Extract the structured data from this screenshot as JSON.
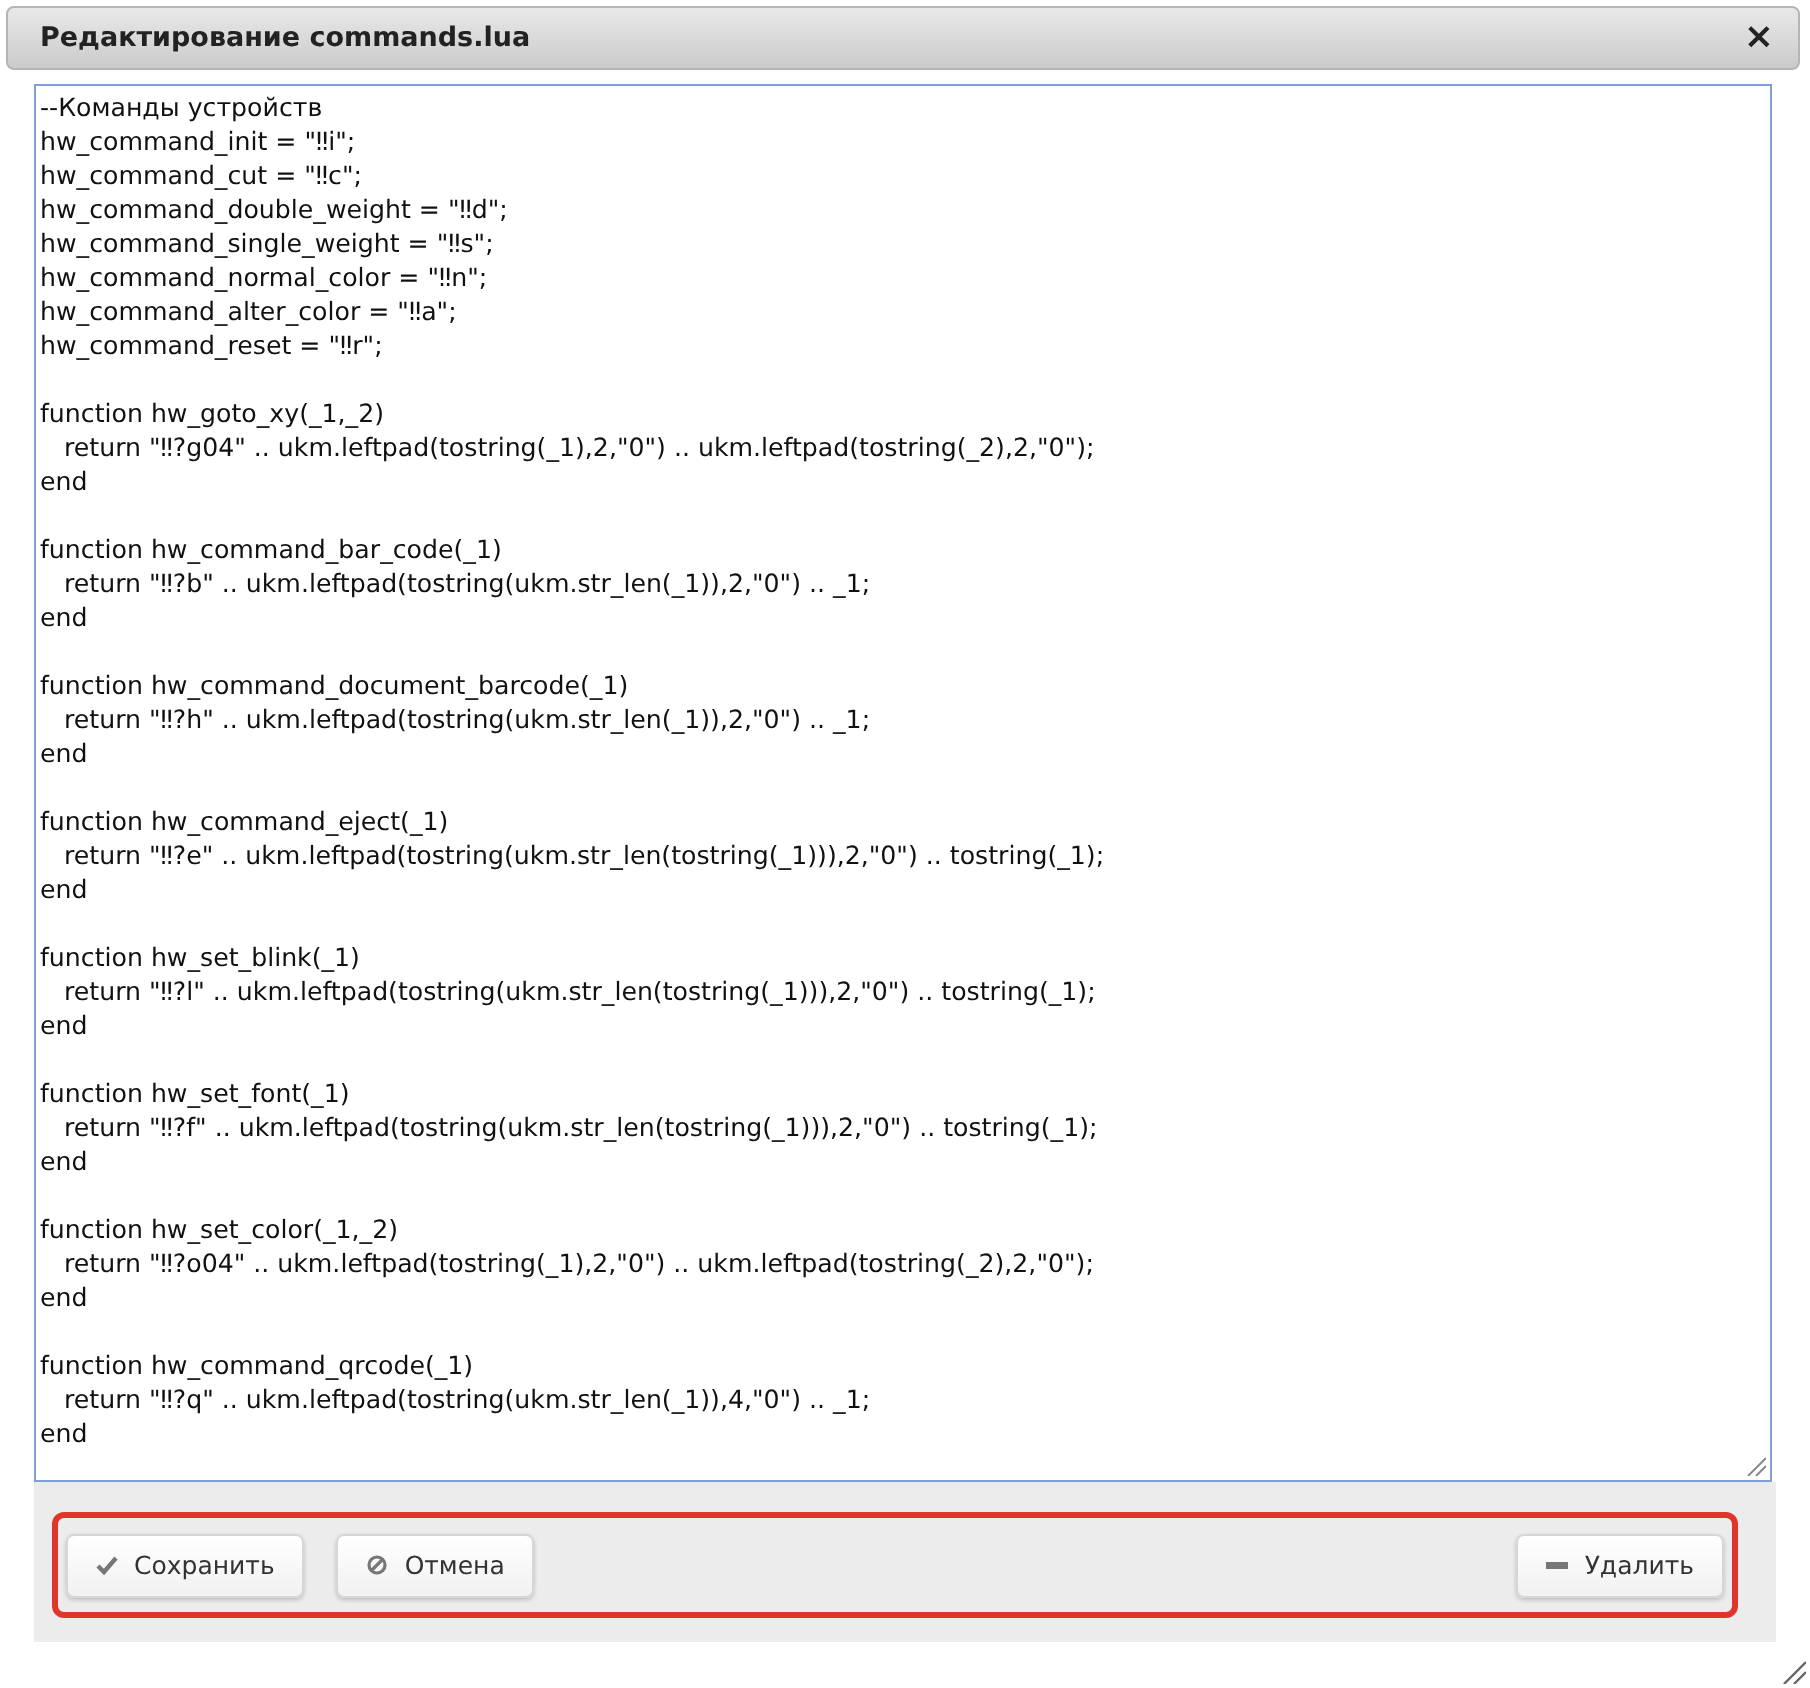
{
  "window": {
    "title": "Редактирование commands.lua",
    "close": "×"
  },
  "editor": {
    "blocks": [
      [
        "--Команды устройств",
        "hw_command_init = \"‼i\";",
        "hw_command_cut = \"‼c\";",
        "hw_command_double_weight = \"‼d\";",
        "hw_command_single_weight = \"‼s\";",
        "hw_command_normal_color = \"‼n\";",
        "hw_command_alter_color = \"‼a\";",
        "hw_command_reset = \"‼r\";"
      ],
      [
        "function hw_goto_xy(_1,_2)",
        "   return \"‼?g04\" .. ukm.leftpad(tostring(_1),2,\"0\") .. ukm.leftpad(tostring(_2),2,\"0\");",
        "end"
      ],
      [
        "function hw_command_bar_code(_1)",
        "   return \"‼?b\" .. ukm.leftpad(tostring(ukm.str_len(_1)),2,\"0\") .. _1;",
        "end"
      ],
      [
        "function hw_command_document_barcode(_1)",
        "   return \"‼?h\" .. ukm.leftpad(tostring(ukm.str_len(_1)),2,\"0\") .. _1;",
        "end"
      ],
      [
        "function hw_command_eject(_1)",
        "   return \"‼?e\" .. ukm.leftpad(tostring(ukm.str_len(tostring(_1))),2,\"0\") .. tostring(_1);",
        "end"
      ],
      [
        "function hw_set_blink(_1)",
        "   return \"‼?l\" .. ukm.leftpad(tostring(ukm.str_len(tostring(_1))),2,\"0\") .. tostring(_1);",
        "end"
      ],
      [
        "function hw_set_font(_1)",
        "   return \"‼?f\" .. ukm.leftpad(tostring(ukm.str_len(tostring(_1))),2,\"0\") .. tostring(_1);",
        "end"
      ],
      [
        "function hw_set_color(_1,_2)",
        "   return \"‼?o04\" .. ukm.leftpad(tostring(_1),2,\"0\") .. ukm.leftpad(tostring(_2),2,\"0\");",
        "end"
      ],
      [
        "function hw_command_qrcode(_1)",
        "   return \"‼?q\" .. ukm.leftpad(tostring(ukm.str_len(_1)),4,\"0\") .. _1;",
        "end"
      ]
    ]
  },
  "left_buttons": [
    {
      "label": "Сохранить",
      "kind": "check"
    },
    {
      "label": "Отмена",
      "kind": "cancel"
    }
  ],
  "right_buttons": [
    {
      "label": "Удалить",
      "kind": "minus"
    }
  ]
}
